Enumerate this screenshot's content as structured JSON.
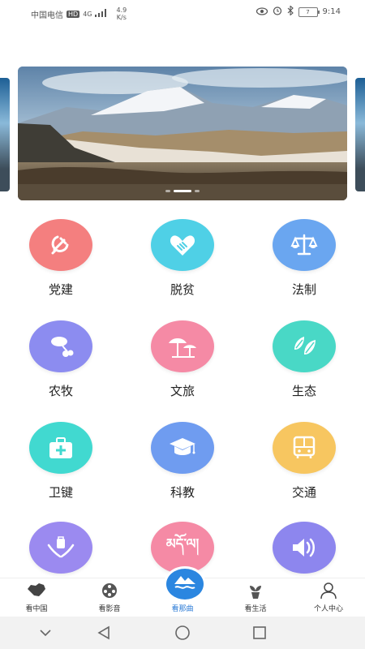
{
  "status_bar": {
    "carrier": "中国电信",
    "hd": "HD",
    "network": "4G",
    "speed_value": "4.9",
    "speed_unit": "K/s",
    "battery": "7",
    "time": "9:14"
  },
  "banner": {
    "slide_count": 3,
    "active_index": 1
  },
  "grid": {
    "tiles": [
      {
        "label": "党建",
        "icon": "hammer-sickle-icon",
        "color": "#f47f7f"
      },
      {
        "label": "脱贫",
        "icon": "heart-hands-icon",
        "color": "#4fd0e6"
      },
      {
        "label": "法制",
        "icon": "scales-icon",
        "color": "#6aa6f0"
      },
      {
        "label": "农牧",
        "icon": "cattle-icon",
        "color": "#8c8cf0"
      },
      {
        "label": "文旅",
        "icon": "beach-umbrella-icon",
        "color": "#f58aa5"
      },
      {
        "label": "生态",
        "icon": "leaves-icon",
        "color": "#49d8c6"
      },
      {
        "label": "卫键",
        "icon": "medical-kit-icon",
        "color": "#41d9d0"
      },
      {
        "label": "科教",
        "icon": "graduation-cap-icon",
        "color": "#6f9cf0"
      },
      {
        "label": "交通",
        "icon": "bus-icon",
        "color": "#f7c660"
      },
      {
        "label": "",
        "icon": "hands-bag-icon",
        "color": "#9b8af0"
      },
      {
        "label": "",
        "icon": "tibetan-text-icon",
        "tibetan": "མདོ་ལ།",
        "color": "#f58aa5"
      },
      {
        "label": "",
        "icon": "speaker-icon",
        "color": "#8d86ee"
      }
    ]
  },
  "bottom_nav": {
    "items": [
      {
        "label": "看中国",
        "icon": "china-map-icon"
      },
      {
        "label": "看影音",
        "icon": "film-reel-icon"
      },
      {
        "label": "看那曲",
        "icon": "mountain-lake-icon",
        "active": true
      },
      {
        "label": "看生活",
        "icon": "plant-pot-icon"
      },
      {
        "label": "个人中心",
        "icon": "user-icon"
      }
    ]
  },
  "system_nav": {
    "items": [
      "collapse-icon",
      "back-icon",
      "home-icon",
      "recents-icon"
    ]
  },
  "colors": {
    "accent": "#2b86e0",
    "active_nav_label": "#2a7ad6"
  }
}
